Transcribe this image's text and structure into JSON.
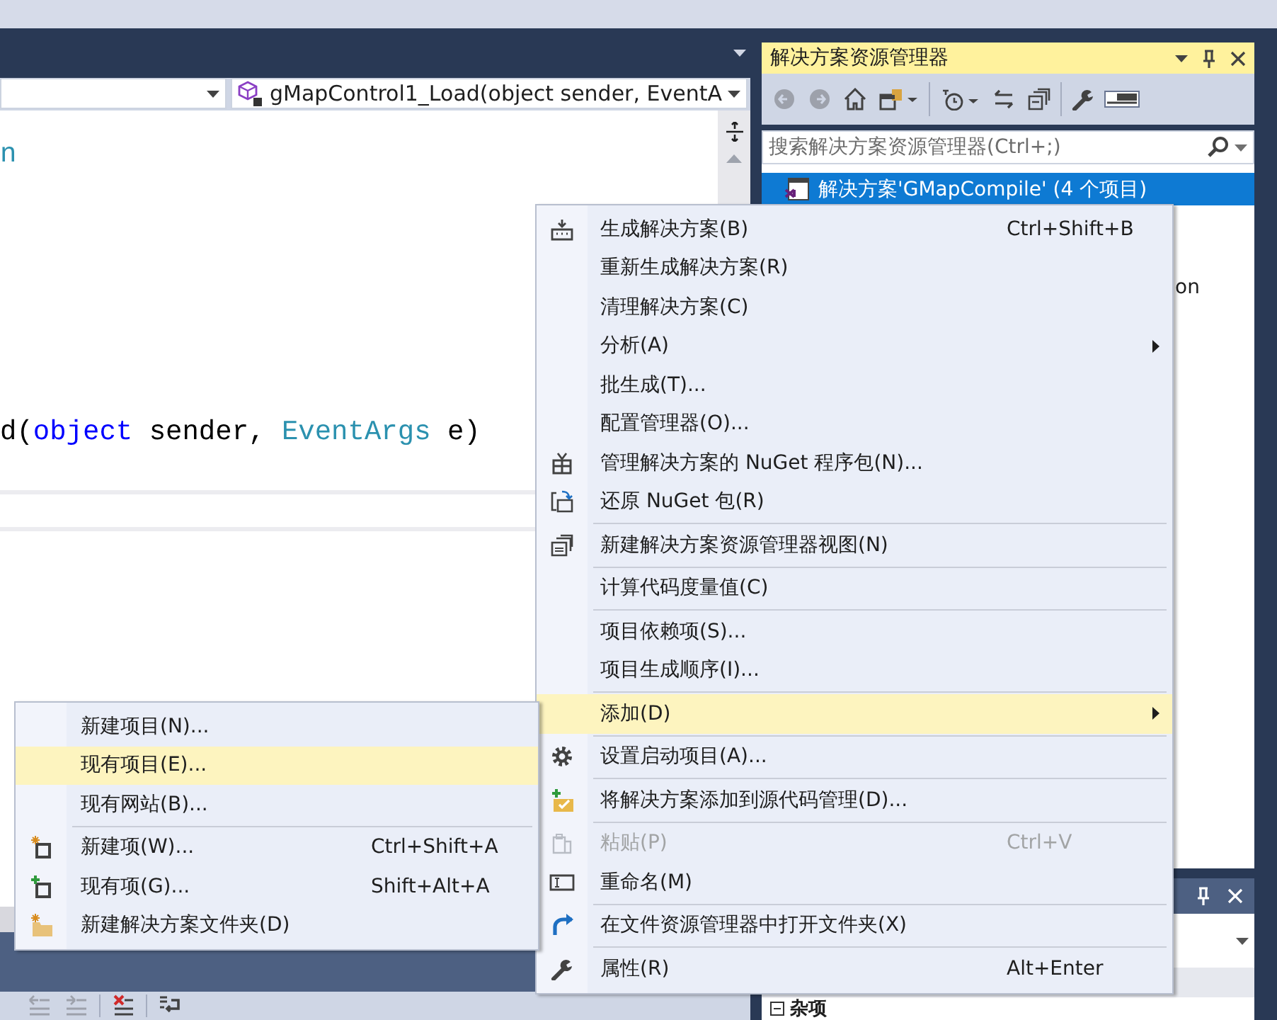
{
  "editor": {
    "member_dropdown": {
      "text": "gMapControl1_Load(object sender, EventA"
    },
    "code_lines": [
      {
        "tokens": [
          {
            "kind": "type",
            "text": "n"
          }
        ]
      },
      {
        "tokens": [
          {
            "kind": "plain",
            "text": "d("
          },
          {
            "kind": "keyword",
            "text": "object"
          },
          {
            "kind": "plain",
            "text": " sender, "
          },
          {
            "kind": "type",
            "text": "EventArgs"
          },
          {
            "kind": "plain",
            "text": " e)"
          }
        ]
      }
    ]
  },
  "solution_explorer": {
    "title": "解决方案资源管理器",
    "toolbar": [
      {
        "kind": "back",
        "disabled": true,
        "pressed": false
      },
      {
        "kind": "forward",
        "disabled": true,
        "pressed": false
      },
      {
        "kind": "home",
        "disabled": false,
        "pressed": false
      },
      {
        "kind": "views",
        "disabled": false,
        "pressed": false
      },
      {
        "kind": "separator"
      },
      {
        "kind": "pending",
        "disabled": false,
        "pressed": false
      },
      {
        "kind": "sync",
        "disabled": false,
        "pressed": false
      },
      {
        "kind": "collapse",
        "disabled": false,
        "pressed": false
      },
      {
        "kind": "separator"
      },
      {
        "kind": "properties",
        "disabled": false,
        "pressed": false
      },
      {
        "kind": "preview",
        "disabled": false,
        "pressed": true
      }
    ],
    "search": {
      "placeholder": "搜索解决方案资源管理器(Ctrl+;)"
    },
    "tree": [
      {
        "label": "解决方案'GMapCompile' (4 个项目)",
        "selected": true
      },
      {
        "label": "on",
        "selected": false
      }
    ]
  },
  "properties": {
    "category": {
      "label": "杂项",
      "expanded": true
    }
  },
  "context_menu": {
    "items": [
      {
        "kind": "item",
        "label": "生成解决方案(B)",
        "shortcut": "Ctrl+Shift+B",
        "selected": false,
        "disabled": false
      },
      {
        "kind": "item",
        "label": "重新生成解决方案(R)",
        "selected": false,
        "disabled": false
      },
      {
        "kind": "item",
        "label": "清理解决方案(C)",
        "selected": false,
        "disabled": false
      },
      {
        "kind": "item",
        "label": "分析(A)",
        "has_submenu": true,
        "selected": false,
        "disabled": false
      },
      {
        "kind": "item",
        "label": "批生成(T)...",
        "selected": false,
        "disabled": false
      },
      {
        "kind": "item",
        "label": "配置管理器(O)...",
        "selected": false,
        "disabled": false
      },
      {
        "kind": "item",
        "label": "管理解决方案的 NuGet 程序包(N)...",
        "selected": false,
        "disabled": false
      },
      {
        "kind": "item",
        "label": "还原 NuGet 包(R)",
        "selected": false,
        "disabled": false
      },
      {
        "kind": "separator"
      },
      {
        "kind": "item",
        "label": "新建解决方案资源管理器视图(N)",
        "selected": false,
        "disabled": false
      },
      {
        "kind": "separator"
      },
      {
        "kind": "item",
        "label": "计算代码度量值(C)",
        "selected": false,
        "disabled": false
      },
      {
        "kind": "separator"
      },
      {
        "kind": "item",
        "label": "项目依赖项(S)...",
        "selected": false,
        "disabled": false
      },
      {
        "kind": "item",
        "label": "项目生成顺序(I)...",
        "selected": false,
        "disabled": false
      },
      {
        "kind": "separator"
      },
      {
        "kind": "item",
        "label": "添加(D)",
        "has_submenu": true,
        "selected": true,
        "disabled": false
      },
      {
        "kind": "separator"
      },
      {
        "kind": "item",
        "label": "设置启动项目(A)...",
        "selected": false,
        "disabled": false
      },
      {
        "kind": "separator"
      },
      {
        "kind": "item",
        "label": "将解决方案添加到源代码管理(D)...",
        "selected": false,
        "disabled": false
      },
      {
        "kind": "separator"
      },
      {
        "kind": "item",
        "label": "粘贴(P)",
        "shortcut": "Ctrl+V",
        "selected": false,
        "disabled": true
      },
      {
        "kind": "item",
        "label": "重命名(M)",
        "selected": false,
        "disabled": false
      },
      {
        "kind": "separator"
      },
      {
        "kind": "item",
        "label": "在文件资源管理器中打开文件夹(X)",
        "selected": false,
        "disabled": false
      },
      {
        "kind": "separator"
      },
      {
        "kind": "item",
        "label": "属性(R)",
        "shortcut": "Alt+Enter",
        "selected": false,
        "disabled": false
      }
    ]
  },
  "submenu": {
    "items": [
      {
        "kind": "item",
        "label": "新建项目(N)...",
        "selected": false,
        "disabled": false
      },
      {
        "kind": "item",
        "label": "现有项目(E)...",
        "selected": true,
        "disabled": false
      },
      {
        "kind": "item",
        "label": "现有网站(B)...",
        "selected": false,
        "disabled": false
      },
      {
        "kind": "separator"
      },
      {
        "kind": "item",
        "label": "新建项(W)...",
        "shortcut": "Ctrl+Shift+A",
        "selected": false,
        "disabled": false
      },
      {
        "kind": "item",
        "label": "现有项(G)...",
        "shortcut": "Shift+Alt+A",
        "selected": false,
        "disabled": false
      },
      {
        "kind": "item",
        "label": "新建解决方案文件夹(D)",
        "selected": false,
        "disabled": false
      }
    ]
  },
  "output_toolbar": [
    {
      "kind": "outdent",
      "disabled": true
    },
    {
      "kind": "indent",
      "disabled": true
    },
    {
      "kind": "separator"
    },
    {
      "kind": "clear",
      "disabled": false
    },
    {
      "kind": "separator"
    },
    {
      "kind": "wrap",
      "disabled": false
    }
  ]
}
